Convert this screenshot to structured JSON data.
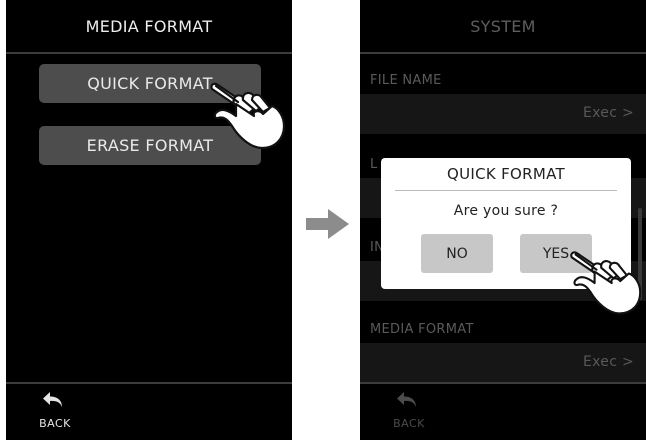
{
  "left_screen": {
    "title": "MEDIA FORMAT",
    "buttons": [
      "QUICK FORMAT",
      "ERASE FORMAT"
    ],
    "back_label": "BACK"
  },
  "right_screen": {
    "title": "SYSTEM",
    "sections": [
      {
        "label": "FILE NAME",
        "value": "Exec >"
      },
      {
        "label": "L"
      },
      {
        "label": "IN"
      },
      {
        "label": "MEDIA FORMAT",
        "value": "Exec >"
      }
    ],
    "back_label": "BACK",
    "dialog": {
      "title": "QUICK FORMAT",
      "question": "Are you sure ?",
      "no_label": "NO",
      "yes_label": "YES"
    }
  },
  "icons": [
    "back-arrow-icon",
    "right-arrow-icon",
    "pointing-hand-icon"
  ],
  "colors": {
    "screen_bg": "#000000",
    "button_bg": "#4d4d4d",
    "dialog_bg": "#ffffff",
    "dialog_button_bg": "#c7c7c7"
  }
}
